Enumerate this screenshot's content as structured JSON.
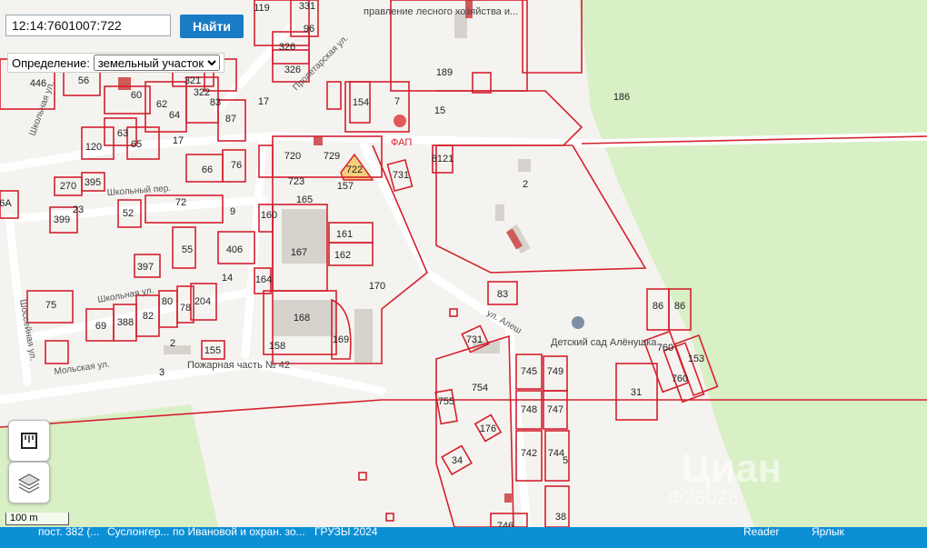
{
  "search": {
    "value": "12:14:7601007:722",
    "button_label": "Найти"
  },
  "definition": {
    "label": "Определение:",
    "selected": "земельный участок"
  },
  "scale_label": "100 m",
  "watermark": {
    "brand": "Циан",
    "number": "Ф26026"
  },
  "parcels": [
    "119",
    "331",
    "96",
    "326",
    "326",
    "446",
    "56",
    "60",
    "62",
    "321",
    "322",
    "64",
    "83",
    "87",
    "17",
    "17",
    "63",
    "65",
    "120",
    "66",
    "76",
    "720",
    "729",
    "722",
    "723",
    "157",
    "154",
    "7",
    "15",
    "189",
    "186",
    "8121",
    "731",
    "2",
    "270",
    "395",
    "72",
    "165",
    "52",
    "399",
    "160",
    "161",
    "162",
    "167",
    "55",
    "406",
    "397",
    "164",
    "14",
    "170",
    "83",
    "75",
    "204",
    "80",
    "78",
    "82",
    "388",
    "69",
    "168",
    "158",
    "169",
    "155",
    "731",
    "86",
    "86",
    "760",
    "760",
    "153",
    "745",
    "749",
    "754",
    "755",
    "748",
    "747",
    "31",
    "176",
    "742",
    "744",
    "34",
    "746",
    "38",
    "5",
    "3",
    "2",
    "9",
    "23",
    "6А"
  ],
  "map_labels": {
    "forestry": "правление лесного хозяйства и...",
    "fap": "ФАП",
    "kindergarten": "Детский сад Алёнушка",
    "fire_station": "Пожарная часть № 42"
  },
  "streets": [
    "Школьный пер.",
    "Школьная ул.",
    "Шоссейная ул.",
    "Школьная ул.",
    "Мольская ул.",
    "Пролетарская ул.",
    "ул. Алеш"
  ],
  "taskbar_items": [
    "пост. 382 (...",
    "Суслонгер...",
    "по Ивановой и охран. зо...",
    "ГРУЗЫ 2024",
    "Reader",
    "Ярлык"
  ],
  "colors": {
    "boundary": "#d4212f",
    "forest": "#d9efc6",
    "road": "#ffffff",
    "selected": "#f6cf7a",
    "button": "#1a7cc4",
    "taskbar": "#0d8fd6"
  }
}
